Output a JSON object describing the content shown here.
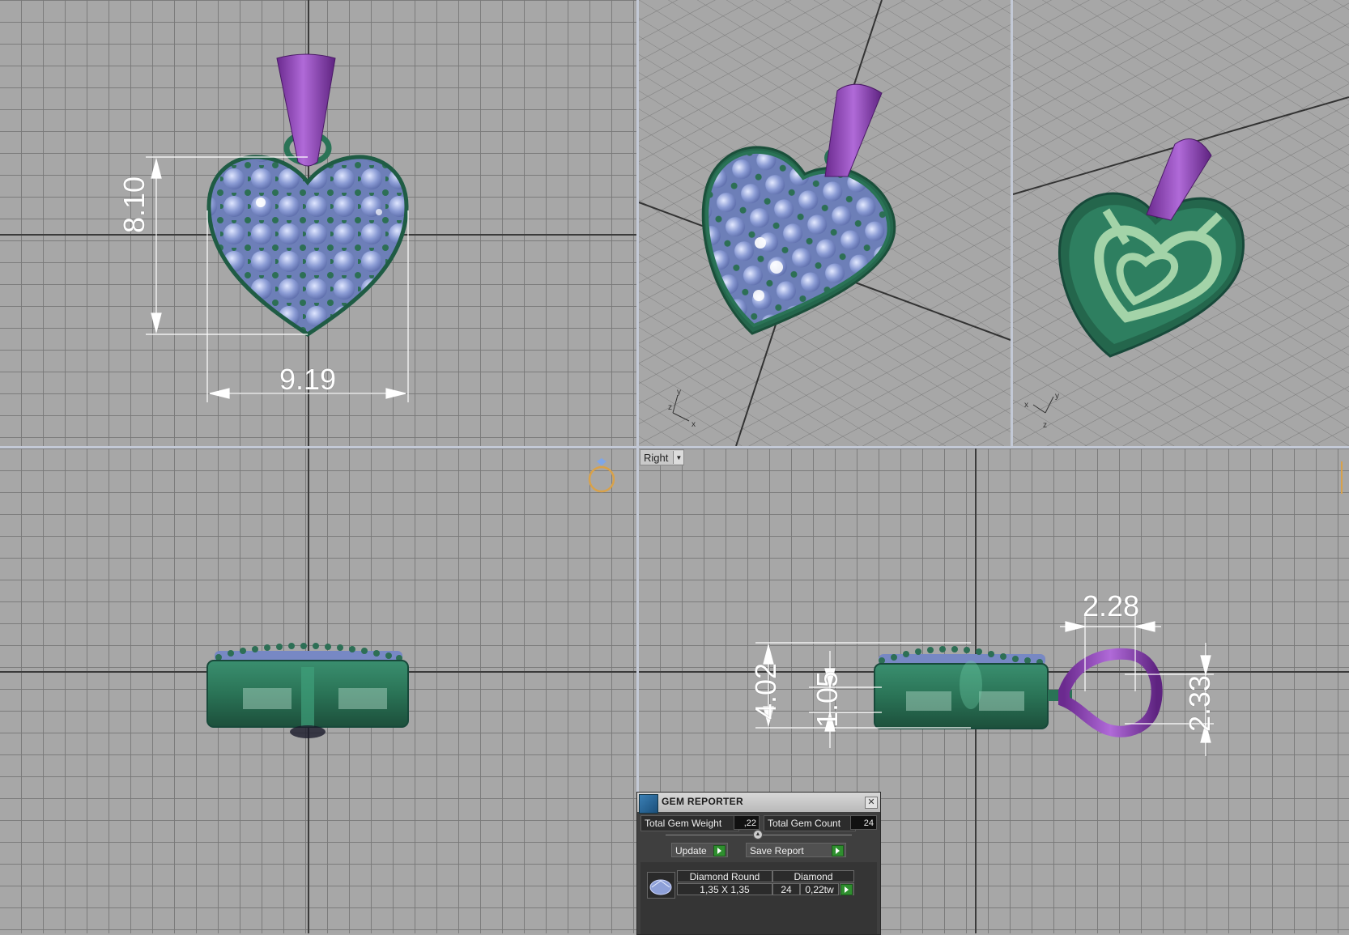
{
  "viewports": {
    "top_left": {
      "dim_height": "8.10",
      "dim_width": "9.19"
    },
    "bottom_right": {
      "label": "Right",
      "dim_a": "2.28",
      "dim_b": "4.02",
      "dim_c": "1.05",
      "dim_d": "2.33"
    }
  },
  "axis_labels": {
    "x": "x",
    "y": "y",
    "z": "z"
  },
  "gem_reporter": {
    "title": "GEM REPORTER",
    "total_weight_label": "Total Gem Weight",
    "total_weight_value": ",22",
    "total_count_label": "Total Gem Count",
    "total_count_value": "24",
    "update_label": "Update",
    "save_label": "Save Report",
    "rows": [
      {
        "name": "Diamond Round",
        "size": "1,35 X 1,35",
        "material": "Diamond",
        "count": "24",
        "weight": "0,22tw"
      }
    ]
  },
  "colors": {
    "metal_green": "#2f7a5f",
    "bail_purple": "#8e3fb0",
    "gem_blue": "#8ea0d8",
    "ring_icon_orange": "#d9a24a"
  }
}
